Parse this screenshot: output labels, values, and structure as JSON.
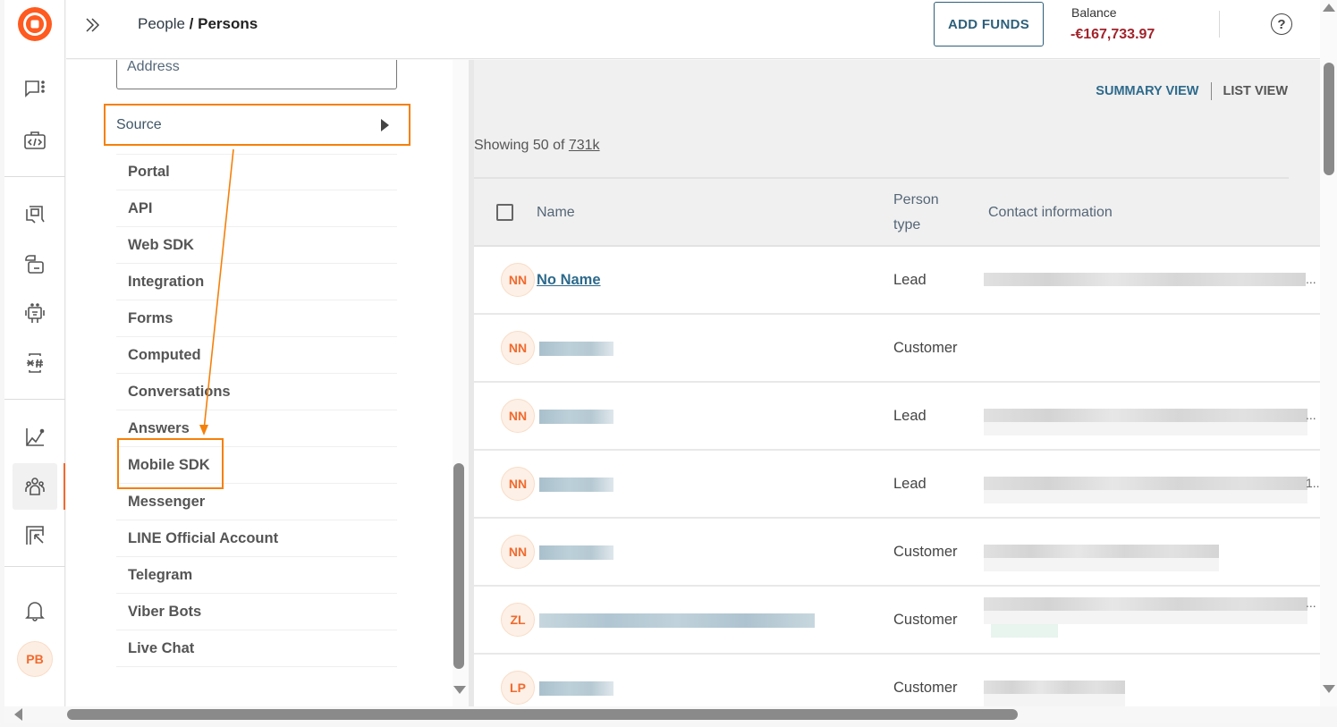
{
  "header": {
    "breadcrumb_parent": "People",
    "breadcrumb_sep": " / ",
    "breadcrumb_current": "Persons",
    "add_funds_label": "ADD FUNDS",
    "balance_label": "Balance",
    "balance_value": "-€167,733.97",
    "help_glyph": "?"
  },
  "rail": {
    "logo": "brand-logo",
    "items": [
      {
        "icon": "conversations-icon"
      },
      {
        "icon": "developer-toolkit-icon"
      },
      {
        "icon": "answers-icon"
      },
      {
        "icon": "moments-icon"
      },
      {
        "icon": "chatbots-icon"
      },
      {
        "icon": "numbers-icon"
      },
      {
        "icon": "analyze-icon"
      },
      {
        "icon": "people-icon",
        "active": true
      },
      {
        "icon": "exports-icon"
      },
      {
        "icon": "notifications-icon"
      }
    ],
    "avatar_initials": "PB"
  },
  "filters": {
    "address_placeholder": "Address",
    "source_label": "Source",
    "source_options": [
      "Portal",
      "API",
      "Web SDK",
      "Integration",
      "Forms",
      "Computed",
      "Conversations",
      "Answers",
      "Mobile SDK",
      "Messenger",
      "LINE Official Account",
      "Telegram",
      "Viber Bots",
      "Live Chat"
    ],
    "highlighted_option": "Mobile SDK"
  },
  "main": {
    "summary_view_label": "SUMMARY VIEW",
    "list_view_label": "LIST VIEW",
    "showing_prefix": "Showing 50 of ",
    "showing_total": "731k",
    "columns": {
      "name": "Name",
      "person_type": "Person type",
      "contact": "Contact information"
    },
    "rows": [
      {
        "initials": "NN",
        "name": "No Name",
        "type": "Lead",
        "contact_redacted": true,
        "ellipsis": "..."
      },
      {
        "initials": "NN",
        "name": "",
        "type": "Customer",
        "contact_redacted": false,
        "ellipsis": ""
      },
      {
        "initials": "NN",
        "name": "",
        "type": "Lead",
        "contact_redacted": true,
        "ellipsis": "..."
      },
      {
        "initials": "NN",
        "name": "",
        "type": "Lead",
        "contact_redacted": true,
        "ellipsis": "1.."
      },
      {
        "initials": "NN",
        "name": "",
        "type": "Customer",
        "contact_redacted": true,
        "ellipsis": ""
      },
      {
        "initials": "ZL",
        "name": "",
        "type": "Customer",
        "contact_redacted": true,
        "ellipsis": "..."
      },
      {
        "initials": "LP",
        "name": "",
        "type": "Customer",
        "contact_redacted": true,
        "ellipsis": ""
      }
    ]
  },
  "colors": {
    "brand_orange": "#f26a2e",
    "highlight_orange": "#f5800a",
    "link_blue": "#2d6a8c",
    "balance_red": "#a1242c"
  }
}
